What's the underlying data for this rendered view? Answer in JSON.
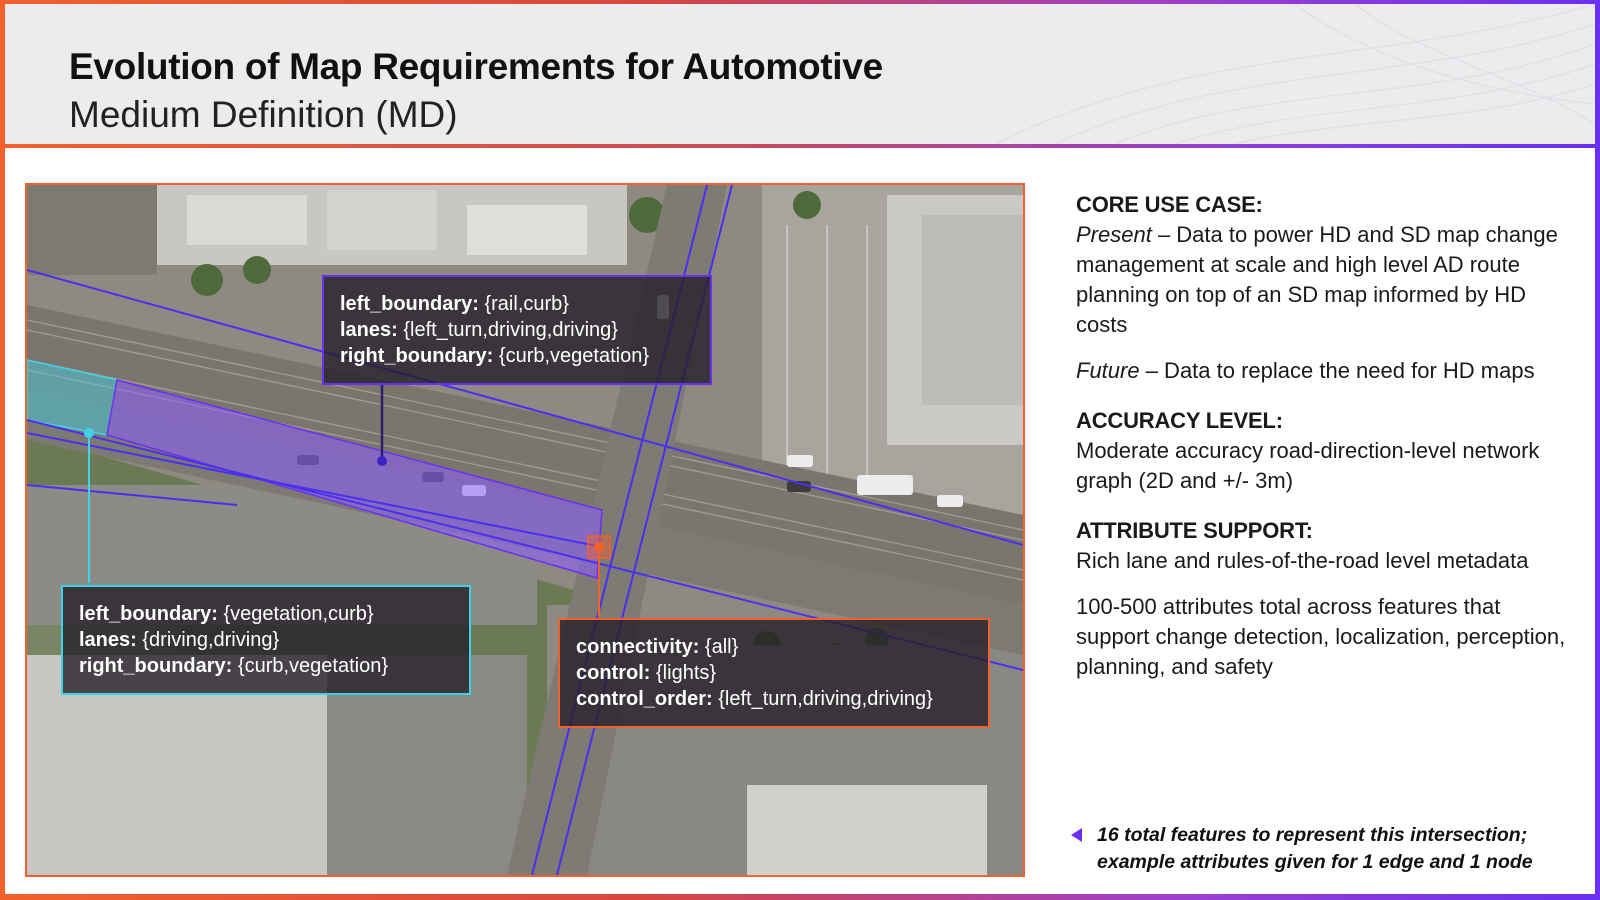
{
  "header": {
    "title": "Evolution of Map Requirements for Automotive",
    "subtitle": "Medium Definition (MD)"
  },
  "map": {
    "callouts": {
      "edge_purple": {
        "color": "#6a2ff0",
        "rows": [
          {
            "key": "left_boundary:",
            "value": "{rail,curb}"
          },
          {
            "key": "lanes:",
            "value": "{left_turn,driving,driving}"
          },
          {
            "key": "right_boundary:",
            "value": "{curb,vegetation}"
          }
        ]
      },
      "edge_cyan": {
        "color": "#3fd3e8",
        "rows": [
          {
            "key": "left_boundary:",
            "value": "{vegetation,curb}"
          },
          {
            "key": "lanes:",
            "value": "{driving,driving}"
          },
          {
            "key": "right_boundary:",
            "value": "{curb,vegetation}"
          }
        ]
      },
      "node_orange": {
        "color": "#f2612c",
        "rows": [
          {
            "key": "connectivity:",
            "value": "{all}"
          },
          {
            "key": "control:",
            "value": "{lights}"
          },
          {
            "key": "control_order:",
            "value": "{left_turn,driving,driving}"
          }
        ]
      }
    }
  },
  "right": {
    "core_heading": "CORE USE CASE:",
    "present_label": "Present",
    "present_text": " – Data to power HD and SD map change management at scale and high level AD route planning on top of an SD map informed by HD costs",
    "future_label": "Future",
    "future_text": " – Data to replace the need for HD maps",
    "accuracy_heading": "ACCURACY LEVEL:",
    "accuracy_text": "Moderate accuracy road-direction-level network graph (2D and +/- 3m)",
    "attribute_heading": "ATTRIBUTE SUPPORT:",
    "attribute_text": "Rich lane and rules-of-the-road level metadata",
    "attribute_total": "100-500 attributes total across features that support change detection, localization, perception, planning, and safety"
  },
  "note": {
    "text_line1": "16 total features to represent this intersection;",
    "text_line2": "example attributes given for 1 edge and 1 node"
  },
  "colors": {
    "accent_orange": "#f2612c",
    "accent_purple": "#6a2ff0",
    "accent_cyan": "#3fd3e8"
  },
  "icons": {
    "note_marker": "left-triangle-icon"
  }
}
